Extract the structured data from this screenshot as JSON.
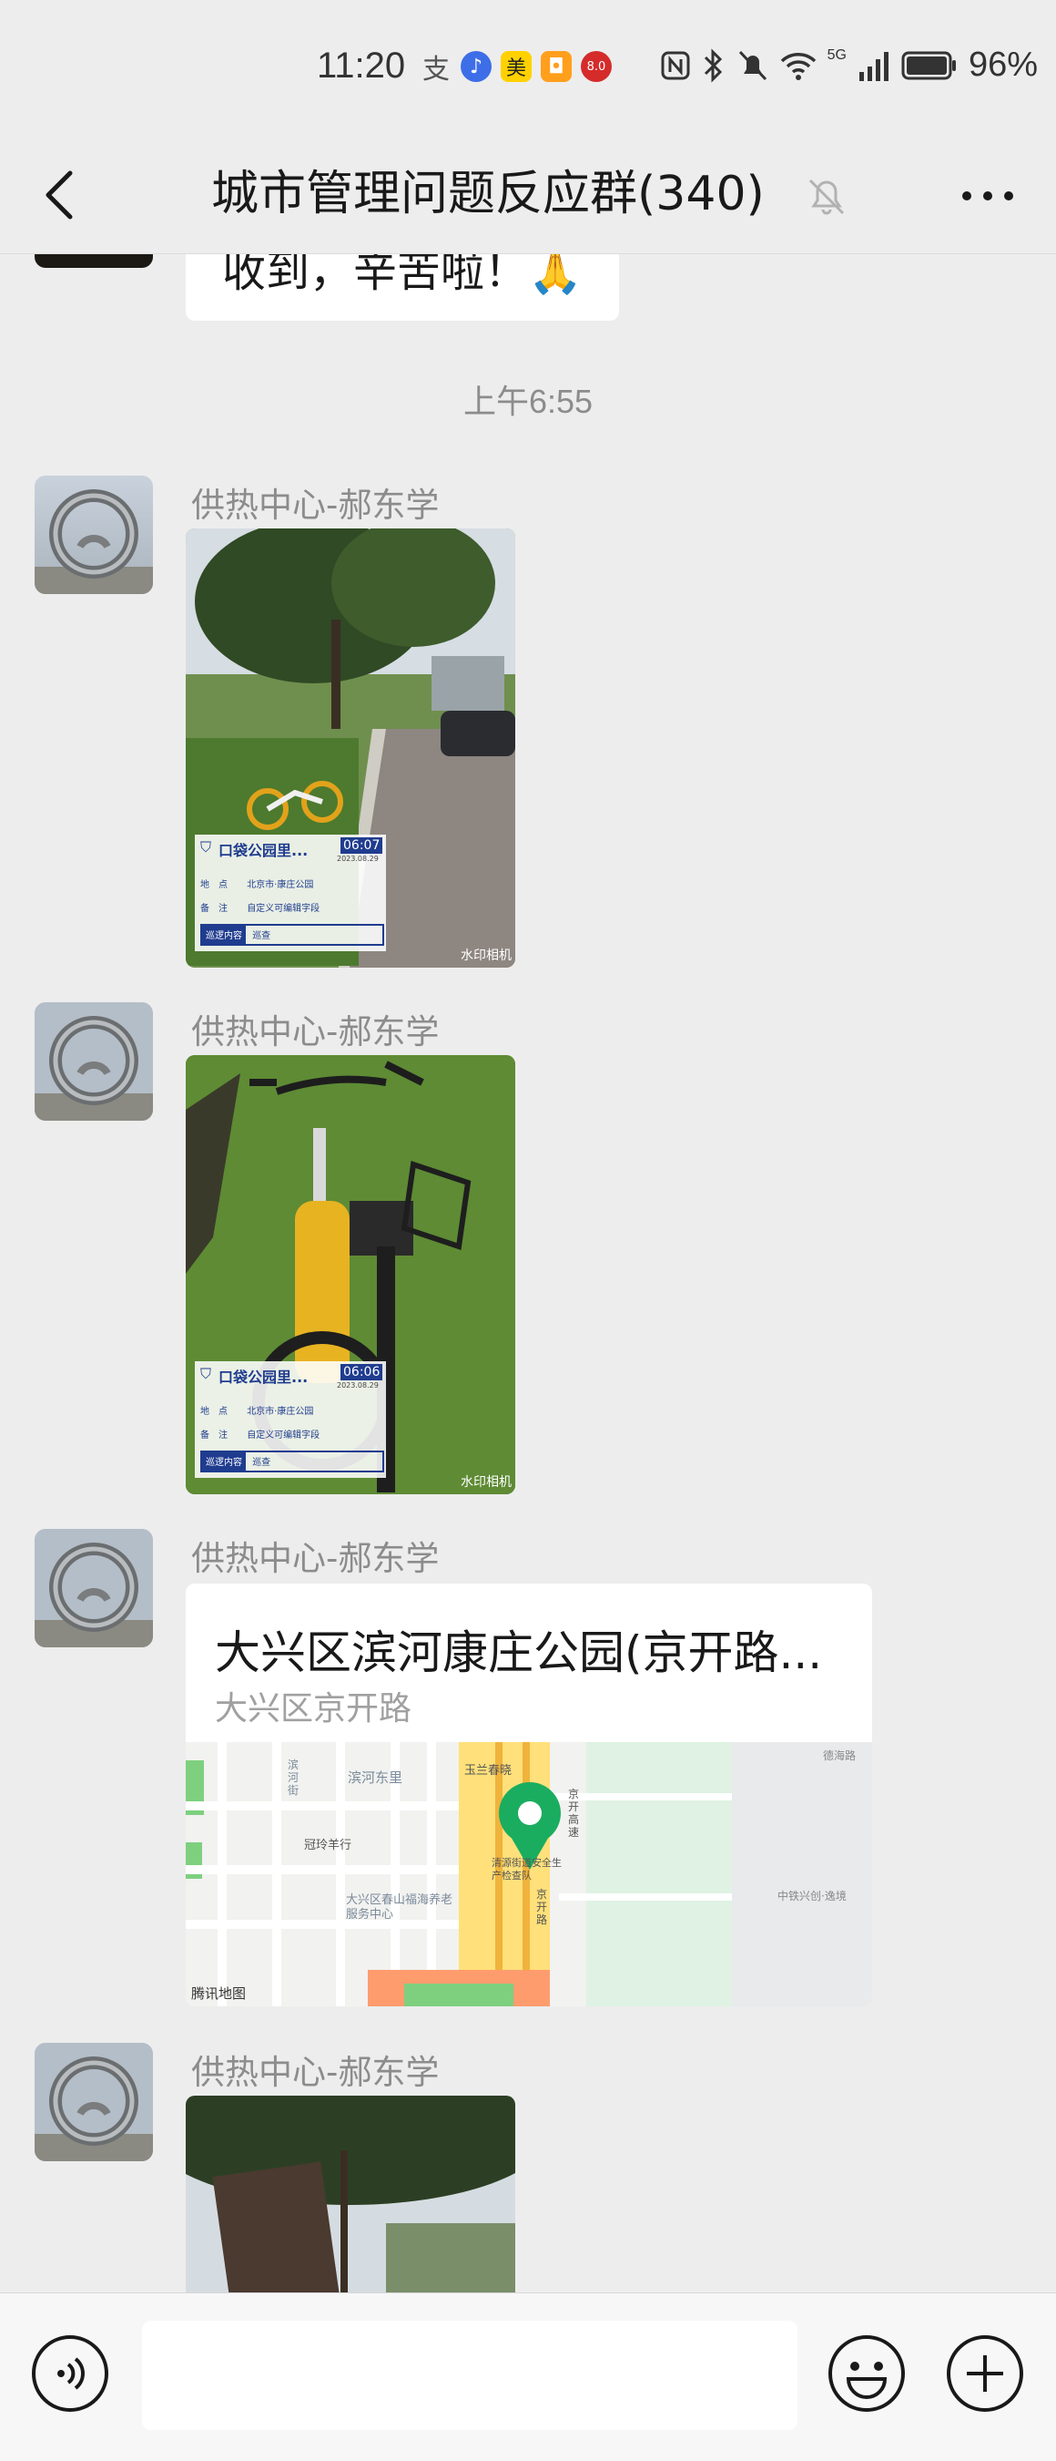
{
  "status_bar": {
    "time": "11:20",
    "app_badge_mei": "美",
    "app_badge_num": "8.0",
    "network": "5G",
    "battery_percent": "96%"
  },
  "header": {
    "title": "城市管理问题反应群(340)"
  },
  "chat": {
    "prev_message": "收到，辛苦啦！🙏",
    "time_divider": "上午6:55",
    "messages": [
      {
        "sender": "供热中心-郝东学",
        "type": "image",
        "watermark": {
          "place": "口袋公园里...",
          "time": "06:07",
          "date": "2023.08.29",
          "row1_key": "地　点",
          "row1_val": "北京市·康庄公园",
          "row2_key": "备　注",
          "row2_val": "自定义可编辑字段",
          "row3_key": "巡逻内容",
          "row3_val": "巡查",
          "brand": "水印相机"
        }
      },
      {
        "sender": "供热中心-郝东学",
        "type": "image",
        "watermark": {
          "place": "口袋公园里...",
          "time": "06:06",
          "date": "2023.08.29",
          "row1_key": "地　点",
          "row1_val": "北京市·康庄公园",
          "row2_key": "备　注",
          "row2_val": "自定义可编辑字段",
          "row3_key": "巡逻内容",
          "row3_val": "巡查",
          "brand": "水印相机"
        }
      },
      {
        "sender": "供热中心-郝东学",
        "type": "location",
        "title": "大兴区滨河康庄公园(京开路...",
        "subtitle": "大兴区京开路",
        "map_labels": {
          "brand": "腾讯地图",
          "l1": "滨河东里",
          "l2": "玉兰春晓",
          "l3": "冠玲羊行",
          "l4": "大兴区春山福海养老服务中心",
          "l5": "清源街道安全生产检查队",
          "l6": "京开高速",
          "l7": "中铁兴创·逸境",
          "l8": "德海路",
          "l9": "滨河街",
          "l10": "京开路"
        }
      },
      {
        "sender": "供热中心-郝东学",
        "type": "image"
      }
    ]
  },
  "input_bar": {
    "placeholder": ""
  }
}
